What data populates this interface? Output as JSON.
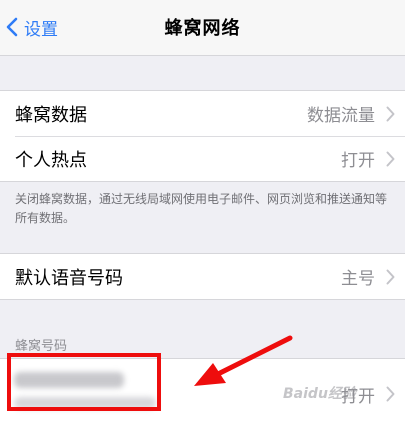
{
  "nav": {
    "back_label": "设置",
    "title": "蜂窝网络"
  },
  "group1": {
    "rows": [
      {
        "label": "蜂窝数据",
        "value": "数据流量"
      },
      {
        "label": "个人热点",
        "value": "打开"
      }
    ]
  },
  "note": "关闭蜂窝数据，通过无线局域网使用电子邮件、网页浏览和推送通知等所有数据。",
  "group2": {
    "rows": [
      {
        "label": "默认语音号码",
        "value": "主号"
      }
    ]
  },
  "section_header": "蜂窝号码",
  "group3": {
    "rows": [
      {
        "value": "打开"
      }
    ]
  },
  "watermark": "Baidu经验",
  "colors": {
    "accent": "#2f7cf6",
    "annotation": "#ee0d0d"
  }
}
